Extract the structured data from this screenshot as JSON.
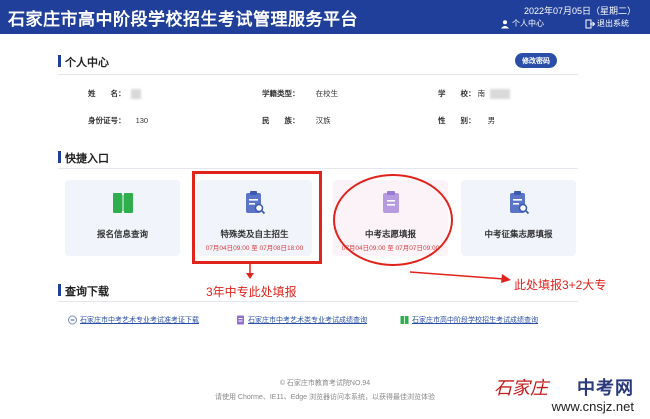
{
  "header": {
    "title": "石家庄市高中阶段学校招生考试管理服务平台",
    "date": "2022年07月05日（星期二）",
    "personal_center": "个人中心",
    "logout": "退出系统"
  },
  "profile": {
    "section_title": "个人中心",
    "edit_password": "修改密码",
    "fields": {
      "name_label": "姓　　名：",
      "school_type_label": "学籍类型：",
      "school_type_value": "在校生",
      "school_label": "学　　校：",
      "school_value": "南",
      "id_label": "身份证号：",
      "id_value": "130",
      "ethnic_label": "民　　族：",
      "ethnic_value": "汉族",
      "gender_label": "性　　别：",
      "gender_value": "男"
    }
  },
  "quick": {
    "section_title": "快捷入口",
    "cards": [
      {
        "label": "报名信息查询",
        "time": ""
      },
      {
        "label": "特殊类及自主招生",
        "time": "07月04日09:00 至 07月08日18:00"
      },
      {
        "label": "中考志愿填报",
        "time": "07月04日09:00 至 07月07日09:00"
      },
      {
        "label": "中考征集志愿填报",
        "time": ""
      }
    ],
    "annotation_left": "3年中专此处填报",
    "annotation_right": "此处填报3+2大专"
  },
  "downloads": {
    "section_title": "查询下载",
    "items": [
      "石家庄市中考艺术专业考试准考证下载",
      "石家庄市中考艺术类专业考试成绩查询",
      "石家庄市高中阶段学校招生考试成绩查询"
    ]
  },
  "footer": {
    "line1": "© 石家庄市教育考试院NO.94",
    "line2": "请使用 Chorme、IE11、Edge 浏览器访问本系统，以获得最佳浏览体验"
  },
  "watermark": {
    "brand": "中考网",
    "calligraphy": "石家庄",
    "url": "www.cnsjz.net"
  },
  "colors": {
    "header": "#1f3f9a",
    "accent": "#2b4fa8",
    "annotation": "#e0231c"
  }
}
